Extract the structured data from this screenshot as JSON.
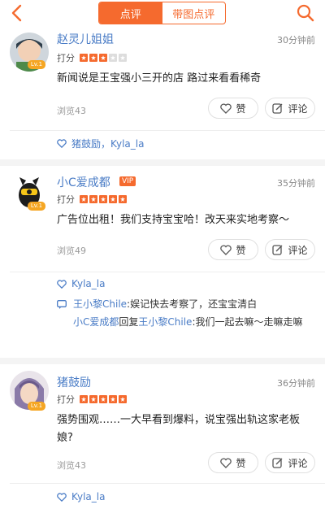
{
  "tabs": {
    "reviews": "点评",
    "photo_reviews": "带图点评"
  },
  "comments": [
    {
      "username": "赵灵儿姐姐",
      "level": "Lv.1",
      "time": "30分钟前",
      "rating_label": "打分",
      "stars": 3,
      "text": "新闻说是王宝强小三开的店 路过来看看稀奇",
      "views": "浏览43",
      "like_label": "赞",
      "comment_label": "评论",
      "likes": "猪鼓励，Kyla_la"
    },
    {
      "username": "小C爱成都",
      "vip": "VIP",
      "level": "Lv.1",
      "time": "35分钟前",
      "rating_label": "打分",
      "stars": 5,
      "text": "广告位出租！我们支持宝宝哈！改天来实地考察～",
      "views": "浏览49",
      "like_label": "赞",
      "comment_label": "评论",
      "likes": "Kyla_la",
      "replies": [
        {
          "name": "王小黎Chile",
          "text": ":娱记快去考察了，还宝宝清白"
        },
        {
          "name": "小C爱成都",
          "mid": "回复",
          "to": "王小黎Chile",
          "text": ":我们一起去嘛～走嘛走嘛"
        }
      ]
    },
    {
      "username": "猪鼓励",
      "level": "Lv.1",
      "time": "36分钟前",
      "rating_label": "打分",
      "stars": 5,
      "text": "强势围观……一大早看到爆料，说宝强出轨这家老板娘?",
      "views": "浏览43",
      "like_label": "赞",
      "comment_label": "评论",
      "likes": "Kyla_la"
    }
  ],
  "icons": {
    "back": "chevron-left-icon",
    "search": "search-icon",
    "like": "heart-icon",
    "comment": "edit-icon"
  },
  "colors": {
    "accent": "#f56a2e",
    "link": "#4a7cc6"
  }
}
